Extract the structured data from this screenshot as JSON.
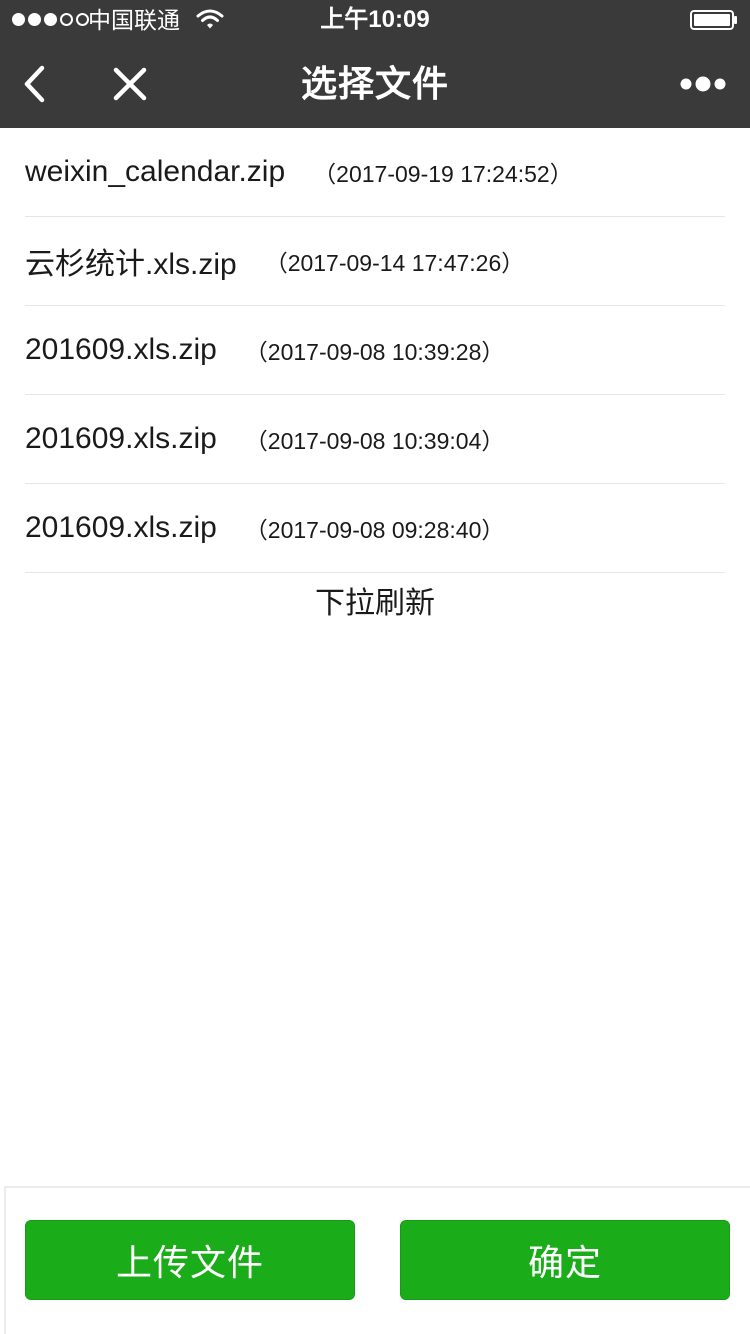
{
  "status_bar": {
    "carrier": "中国联通",
    "time": "上午10:09",
    "signal_bars_filled": 3,
    "signal_bars_total": 5
  },
  "nav": {
    "title": "选择文件",
    "back_icon": "chevron-left-icon",
    "close_icon": "close-icon",
    "more_icon": "more-dots-icon"
  },
  "files": [
    {
      "name": "weixin_calendar.zip",
      "time": "（2017-09-19 17:24:52）"
    },
    {
      "name": "云杉统计.xls.zip",
      "time": "（2017-09-14 17:47:26）"
    },
    {
      "name": "201609.xls.zip",
      "time": "（2017-09-08 10:39:28）"
    },
    {
      "name": "201609.xls.zip",
      "time": "（2017-09-08 10:39:04）"
    },
    {
      "name": "201609.xls.zip",
      "time": "（2017-09-08 09:28:40）"
    }
  ],
  "refresh_hint": "下拉刷新",
  "actions": {
    "upload_label": "上传文件",
    "confirm_label": "确定"
  },
  "colors": {
    "nav_bg": "#3a3a3a",
    "primary_green": "#1aad19"
  }
}
